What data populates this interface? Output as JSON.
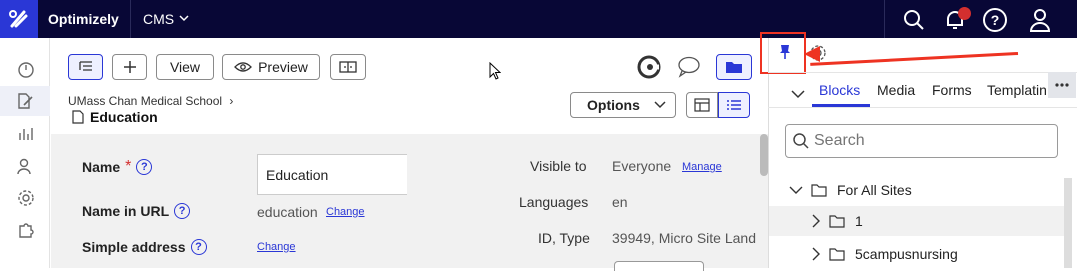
{
  "topbar": {
    "brand": "Optimizely",
    "product": "CMS",
    "icons": [
      "search-icon",
      "bell-icon",
      "help-icon",
      "user-icon"
    ]
  },
  "toolbar": {
    "view_label": "View",
    "preview_label": "Preview"
  },
  "page": {
    "breadcrumb": "UMass Chan Medical School",
    "title": "Education",
    "options_label": "Options"
  },
  "form": {
    "name_label": "Name",
    "name_value": "Education",
    "url_label": "Name in URL",
    "url_value": "education",
    "url_change": "Change",
    "simple_label": "Simple address",
    "simple_change": "Change",
    "visible_label": "Visible to",
    "visible_value": "Everyone",
    "visible_manage": "Manage",
    "languages_label": "Languages",
    "languages_value": "en",
    "id_label": "ID, Type",
    "id_value": "39949, Micro Site Land"
  },
  "assets": {
    "tabs": [
      "Blocks",
      "Media",
      "Forms",
      "Templating"
    ],
    "active_tab": "Blocks",
    "search_placeholder": "Search",
    "tree": [
      {
        "label": "For All Sites",
        "level": 0,
        "expanded": true
      },
      {
        "label": "1",
        "level": 1,
        "expanded": false
      },
      {
        "label": "5campusnursing",
        "level": 1,
        "expanded": false
      }
    ]
  },
  "colors": {
    "topbar": "#080736",
    "accent": "#2a37d6",
    "annotation": "#ee3322"
  }
}
